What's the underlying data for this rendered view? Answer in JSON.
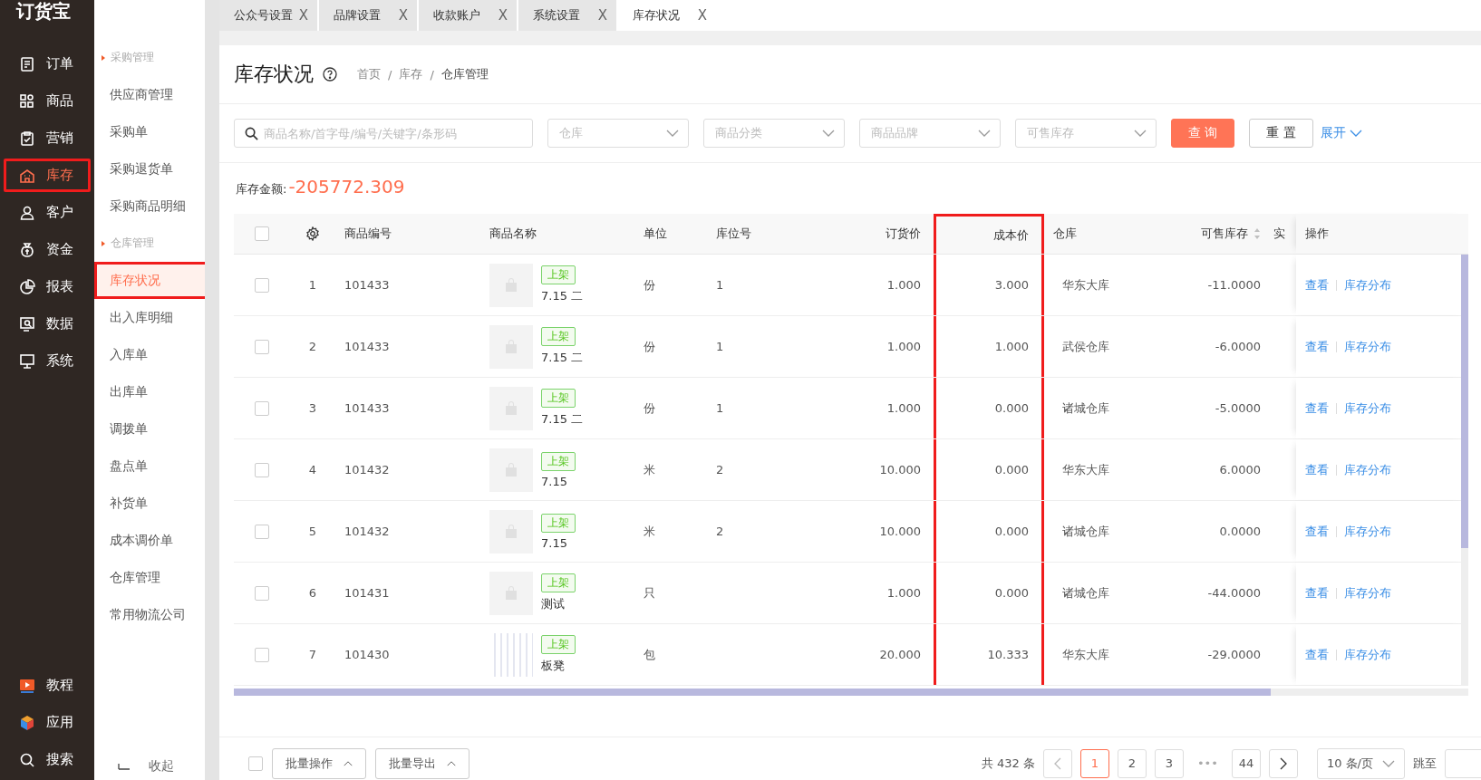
{
  "logo": "订货宝",
  "nav": [
    {
      "label": "订单",
      "selected": false,
      "highlighted": false
    },
    {
      "label": "商品",
      "selected": false,
      "highlighted": false
    },
    {
      "label": "营销",
      "selected": false,
      "highlighted": false
    },
    {
      "label": "库存",
      "selected": true,
      "highlighted": true
    },
    {
      "label": "客户",
      "selected": false,
      "highlighted": false
    },
    {
      "label": "资金",
      "selected": false,
      "highlighted": false
    },
    {
      "label": "报表",
      "selected": false,
      "highlighted": false
    },
    {
      "label": "数据",
      "selected": false,
      "highlighted": false
    },
    {
      "label": "系统",
      "selected": false,
      "highlighted": false
    }
  ],
  "nav_bottom": [
    {
      "label": "教程"
    },
    {
      "label": "应用"
    },
    {
      "label": "搜索"
    }
  ],
  "submenu": [
    {
      "kind": "group",
      "label": "采购管理"
    },
    {
      "kind": "item",
      "label": "供应商管理",
      "selected": false,
      "highlighted": false
    },
    {
      "kind": "item",
      "label": "采购单",
      "selected": false,
      "highlighted": false
    },
    {
      "kind": "item",
      "label": "采购退货单",
      "selected": false,
      "highlighted": false
    },
    {
      "kind": "item",
      "label": "采购商品明细",
      "selected": false,
      "highlighted": false
    },
    {
      "kind": "group",
      "label": "仓库管理"
    },
    {
      "kind": "item",
      "label": "库存状况",
      "selected": true,
      "highlighted": true
    },
    {
      "kind": "item",
      "label": "出入库明细",
      "selected": false,
      "highlighted": false
    },
    {
      "kind": "item",
      "label": "入库单",
      "selected": false,
      "highlighted": false
    },
    {
      "kind": "item",
      "label": "出库单",
      "selected": false,
      "highlighted": false
    },
    {
      "kind": "item",
      "label": "调拨单",
      "selected": false,
      "highlighted": false
    },
    {
      "kind": "item",
      "label": "盘点单",
      "selected": false,
      "highlighted": false
    },
    {
      "kind": "item",
      "label": "补货单",
      "selected": false,
      "highlighted": false
    },
    {
      "kind": "item",
      "label": "成本调价单",
      "selected": false,
      "highlighted": false
    },
    {
      "kind": "item",
      "label": "仓库管理",
      "selected": false,
      "highlighted": false
    },
    {
      "kind": "item",
      "label": "常用物流公司",
      "selected": false,
      "highlighted": false
    }
  ],
  "collapse_label": "收起",
  "tabs": [
    {
      "label": "公众号设置",
      "selected": false,
      "close": "X"
    },
    {
      "label": "品牌设置",
      "selected": false,
      "close": "X"
    },
    {
      "label": "收款账户",
      "selected": false,
      "close": "X"
    },
    {
      "label": "系统设置",
      "selected": false,
      "close": "X"
    },
    {
      "label": "库存状况",
      "selected": true,
      "close": "X"
    }
  ],
  "page": {
    "title": "库存状况",
    "breadcrumb": [
      "首页",
      "库存",
      "仓库管理"
    ],
    "separator": "/"
  },
  "filters": {
    "search_placeholder": "商品名称/首字母/编号/关键字/条形码",
    "selects": [
      "仓库",
      "商品分类",
      "商品品牌",
      "可售库存"
    ],
    "query_button": "查 询",
    "reset_button": "重 置",
    "expand_link": "展开"
  },
  "summary": {
    "label": "库存金额:",
    "value": "-205772.309"
  },
  "table": {
    "header_checked": false,
    "columns": [
      {
        "label": "商品编号",
        "highlighted": false,
        "sortable": false
      },
      {
        "label": "商品名称",
        "highlighted": false,
        "sortable": false
      },
      {
        "label": "单位",
        "highlighted": false,
        "sortable": false
      },
      {
        "label": "库位号",
        "highlighted": false,
        "sortable": false
      },
      {
        "label": "订货价",
        "highlighted": false,
        "sortable": false
      },
      {
        "label": "成本价",
        "highlighted": true,
        "sortable": false
      },
      {
        "label": "仓库",
        "highlighted": false,
        "sortable": false
      },
      {
        "label": "可售库存",
        "highlighted": false,
        "sortable": true
      },
      {
        "label": "实",
        "highlighted": false,
        "sortable": false
      },
      {
        "label": "操作",
        "highlighted": false,
        "sortable": false
      }
    ],
    "rows": [
      {
        "checked": false,
        "index": "1",
        "code": "101433",
        "unit": "份",
        "location": "1",
        "order_price": "1.000",
        "cost_price": "3.000",
        "warehouse": "华东大库",
        "sellable": "-11.0000",
        "kind": "placeholder",
        "status": "上架",
        "name": "7.15 二",
        "actions": [
          "查看",
          "库存分布"
        ]
      },
      {
        "checked": false,
        "index": "2",
        "code": "101433",
        "unit": "份",
        "location": "1",
        "order_price": "1.000",
        "cost_price": "1.000",
        "warehouse": "武侯仓库",
        "sellable": "-6.0000",
        "kind": "placeholder",
        "status": "上架",
        "name": "7.15 二",
        "actions": [
          "查看",
          "库存分布"
        ]
      },
      {
        "checked": false,
        "index": "3",
        "code": "101433",
        "unit": "份",
        "location": "1",
        "order_price": "1.000",
        "cost_price": "0.000",
        "warehouse": "诸城仓库",
        "sellable": "-5.0000",
        "kind": "placeholder",
        "status": "上架",
        "name": "7.15 二",
        "actions": [
          "查看",
          "库存分布"
        ]
      },
      {
        "checked": false,
        "index": "4",
        "code": "101432",
        "unit": "米",
        "location": "2",
        "order_price": "10.000",
        "cost_price": "0.000",
        "warehouse": "华东大库",
        "sellable": "6.0000",
        "kind": "placeholder",
        "status": "上架",
        "name": "7.15",
        "actions": [
          "查看",
          "库存分布"
        ]
      },
      {
        "checked": false,
        "index": "5",
        "code": "101432",
        "unit": "米",
        "location": "2",
        "order_price": "10.000",
        "cost_price": "0.000",
        "warehouse": "诸城仓库",
        "sellable": "0.0000",
        "kind": "placeholder",
        "status": "上架",
        "name": "7.15",
        "actions": [
          "查看",
          "库存分布"
        ]
      },
      {
        "checked": false,
        "index": "6",
        "code": "101431",
        "unit": "只",
        "order_price": "1.000",
        "cost_price": "0.000",
        "warehouse": "诸城仓库",
        "sellable": "-44.0000",
        "kind": "placeholder",
        "status": "上架",
        "name": "测试",
        "actions": [
          "查看",
          "库存分布"
        ]
      },
      {
        "checked": false,
        "index": "7",
        "code": "101430",
        "unit": "包",
        "order_price": "20.000",
        "cost_price": "10.333",
        "warehouse": "华东大库",
        "sellable": "-29.0000",
        "kind": "photo",
        "status": "上架",
        "name": "板凳",
        "actions": [
          "查看",
          "库存分布"
        ]
      }
    ]
  },
  "footer": {
    "checked": false,
    "batch_buttons": [
      "批量操作",
      "批量导出"
    ],
    "total": "共 432 条",
    "pages": [
      {
        "label": "1",
        "selected": true
      },
      {
        "label": "2",
        "selected": false
      },
      {
        "label": "3",
        "selected": false
      }
    ],
    "ellipsis": "•••",
    "last_page": "44",
    "page_size": "10 条/页",
    "jump_label": "跳至"
  }
}
